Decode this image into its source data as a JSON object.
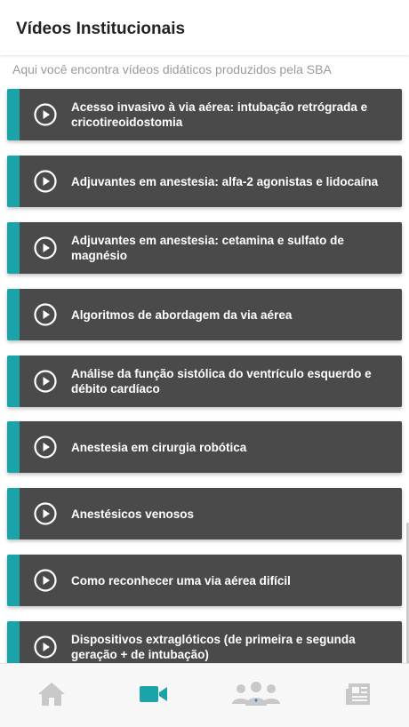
{
  "header": {
    "title": "Vídeos Institucionais"
  },
  "subtitle": "Aqui você encontra vídeos didáticos produzidos pela SBA",
  "colors": {
    "accent": "#1aa3a8",
    "card": "#4a4a4a",
    "nav_icon": "#c8c8c8",
    "nav_active": "#1aa3a8"
  },
  "videos": [
    {
      "title": "Acesso invasivo à via aérea: intubação retrógrada e cricotireoidostomia"
    },
    {
      "title": "Adjuvantes em anestesia: alfa-2 agonistas e lidocaína"
    },
    {
      "title": "Adjuvantes em anestesia: cetamina e sulfato de magnésio"
    },
    {
      "title": "Algoritmos de abordagem da via aérea"
    },
    {
      "title": "Análise da função sistólica do ventrículo esquerdo e débito cardíaco"
    },
    {
      "title": "Anestesia em cirurgia robótica"
    },
    {
      "title": "Anestésicos venosos"
    },
    {
      "title": "Como reconhecer uma via aérea difícil"
    },
    {
      "title": "Dispositivos extraglóticos (de primeira e segunda geração + de intubação)"
    }
  ],
  "nav": [
    {
      "name": "home",
      "icon": "home-icon",
      "active": false
    },
    {
      "name": "videos",
      "icon": "video-camera-icon",
      "active": true
    },
    {
      "name": "community",
      "icon": "people-group-icon",
      "active": false
    },
    {
      "name": "news",
      "icon": "newspaper-icon",
      "active": false
    }
  ]
}
